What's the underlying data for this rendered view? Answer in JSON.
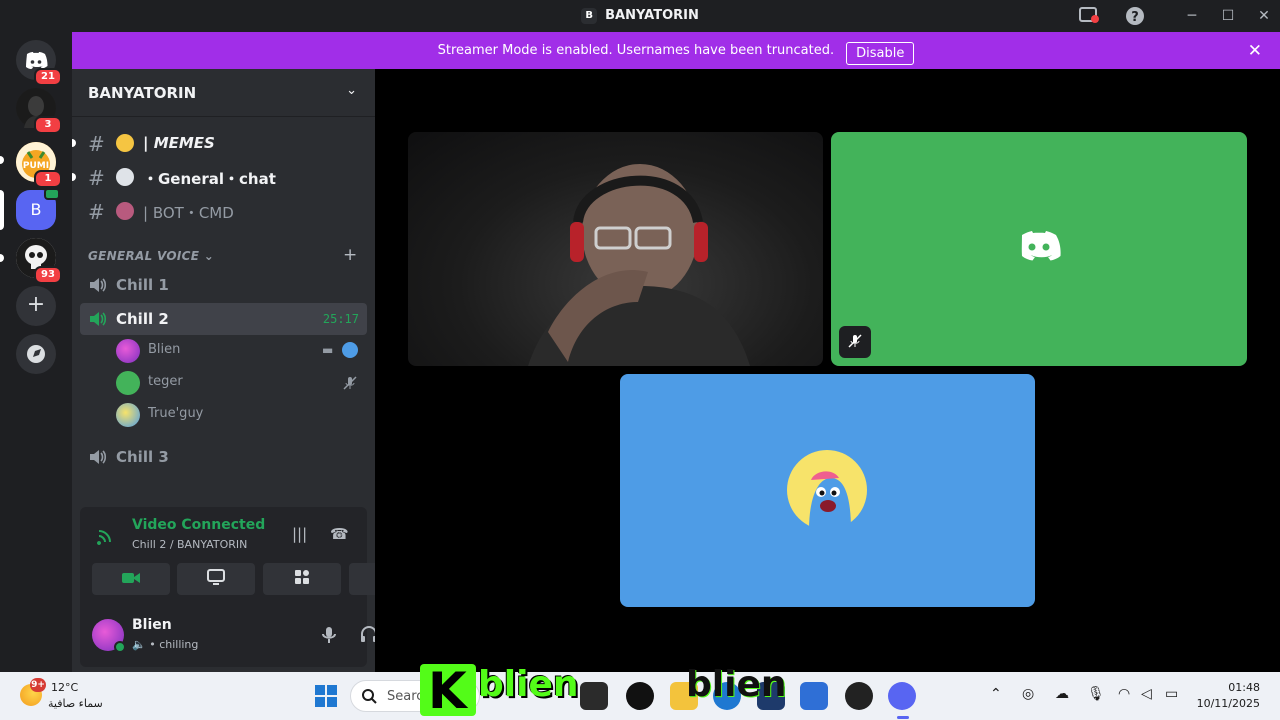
{
  "window": {
    "title": "BANYATORIN",
    "title_badge": "B"
  },
  "banner": {
    "message": "Streamer Mode is enabled. Usernames have been truncated.",
    "button": "Disable",
    "close": "✕"
  },
  "rail": {
    "servers": [
      {
        "name": "direct-messages",
        "badge": "21",
        "color": "#313338"
      },
      {
        "name": "dark-server",
        "badge": "3",
        "color": "#2a2a2a"
      },
      {
        "name": "pumi-server",
        "badge": "1",
        "color": "#f5a623"
      },
      {
        "name": "banyatorin-server",
        "badge": "",
        "letter": "B",
        "color": "#5865f2"
      },
      {
        "name": "skull-server",
        "badge": "93",
        "color": "#e8e8e8"
      }
    ],
    "add_label": "+",
    "explore_label": "⌾"
  },
  "sidebar": {
    "server_name": "BANYATORIN",
    "text_channels": [
      {
        "name": "| 𝙈𝙀𝙈𝙀𝙎",
        "emoji_color": "#f5c542",
        "unread": true,
        "muted": false
      },
      {
        "name": "・General・chat",
        "emoji_color": "#dfe3e8",
        "unread": true,
        "muted": false
      },
      {
        "name": "| BOT・CMD",
        "emoji_color": "#b85a7e",
        "unread": false,
        "muted": true
      }
    ],
    "voice_category": "GENERAL VOICE",
    "voice_channels": [
      {
        "name": "Chill 1",
        "active": false
      },
      {
        "name": "Chill 2",
        "active": true,
        "timer": "25:17"
      },
      {
        "name": "Chill 3",
        "active": false
      }
    ],
    "members": [
      {
        "name": "Blien",
        "avatar_color": "#a54ad9"
      },
      {
        "name": "teger",
        "avatar_color": "#43b35a"
      },
      {
        "name": "True'guy",
        "avatar_color": "#4e9ce6"
      }
    ]
  },
  "voice_panel": {
    "status": "Video Connected",
    "location": "Chill 2 / BANYATORIN"
  },
  "user_panel": {
    "name": "Blien",
    "status": "chilling"
  },
  "taskbar": {
    "weather_temp": "12°C",
    "weather_desc": "سماء صافية",
    "weather_badge": "9+",
    "search_placeholder": "Search",
    "overlay_text_1": "blien",
    "overlay_text_2": "blien",
    "time": "01:48",
    "date": "10/11/2025"
  },
  "colors": {
    "accent_purple": "#a12ee8",
    "voice_green": "#23a55a",
    "tile_green": "#43b35a",
    "tile_blue": "#4e9ce6",
    "kick_green": "#53fc18"
  }
}
